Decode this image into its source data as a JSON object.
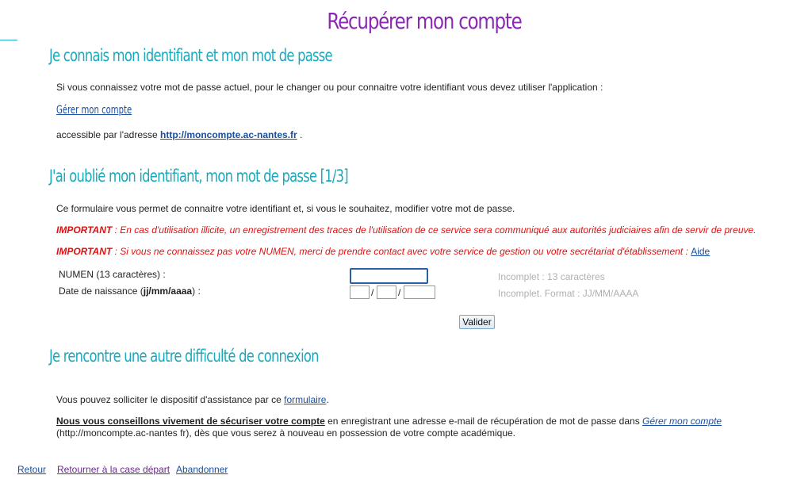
{
  "page": {
    "title": "Récupérer mon compte"
  },
  "section1": {
    "title": "Je connais mon identifiant et mon mot de passe",
    "intro": "Si vous connaissez votre mot de passe actuel, pour le changer ou pour connaitre votre identifiant vous devez utiliser l'application :",
    "app_link": "Gérer mon compte",
    "address_prefix": "accessible par l'adresse ",
    "address_link": "http://moncompte.ac-nantes.fr",
    "address_suffix": " ."
  },
  "section2": {
    "title": "J'ai oublié mon identifiant, mon mot de passe [1/3]",
    "intro": "Ce formulaire vous permet de connaitre votre identifiant et, si vous le souhaitez, modifier votre mot de passe.",
    "important_label": "IMPORTANT",
    "important1": " : En cas d'utilisation illicite, un enregistrement des traces de l'utilisation de ce service sera communiqué aux autorités judiciaires afin de servir de preuve.",
    "important2": " : Si vous ne connaissez pas votre NUMEN, merci de prendre contact avec votre service de gestion ou votre secrétariat d'établissement : ",
    "aide_link": "Aide",
    "numen_label": "NUMEN (13 caractères) :",
    "numen_value": "",
    "numen_hint": "Incomplet : 13 caractères",
    "birth_label_prefix": "Date de naissance (",
    "birth_label_format": "jj/mm/aaaa",
    "birth_label_suffix": ") :",
    "birth_day": "",
    "birth_month": "",
    "birth_year": "",
    "date_separator": "/",
    "birth_hint": "Incomplet. Format : JJ/MM/AAAA",
    "submit_label": "Valider"
  },
  "section3": {
    "title": "Je rencontre une autre difficulté de connexion",
    "assist_prefix": "Vous pouvez solliciter le dispositif d'assistance par ce ",
    "assist_link": "formulaire",
    "assist_suffix": ".",
    "advice_strong": "Nous vous conseillons vivement de sécuriser votre compte",
    "advice_middle": " en enregistrant une adresse e-mail de récupération de mot de passe dans ",
    "advice_link": "Gérer mon compte",
    "advice_end": " (http://moncompte.ac-nantes fr), dès que vous serez à nouveau en possession de votre compte académique."
  },
  "footer": {
    "back": "Retour",
    "restart": "Retourner à la case départ",
    "abandon": "Abandonner"
  },
  "colors": {
    "title": "#8a28b4",
    "section_title": "#1aa9bb",
    "link": "#1a4ea0",
    "visited_link": "#6a2a8a",
    "important": "#e01010",
    "hint": "#b0b0b0"
  }
}
